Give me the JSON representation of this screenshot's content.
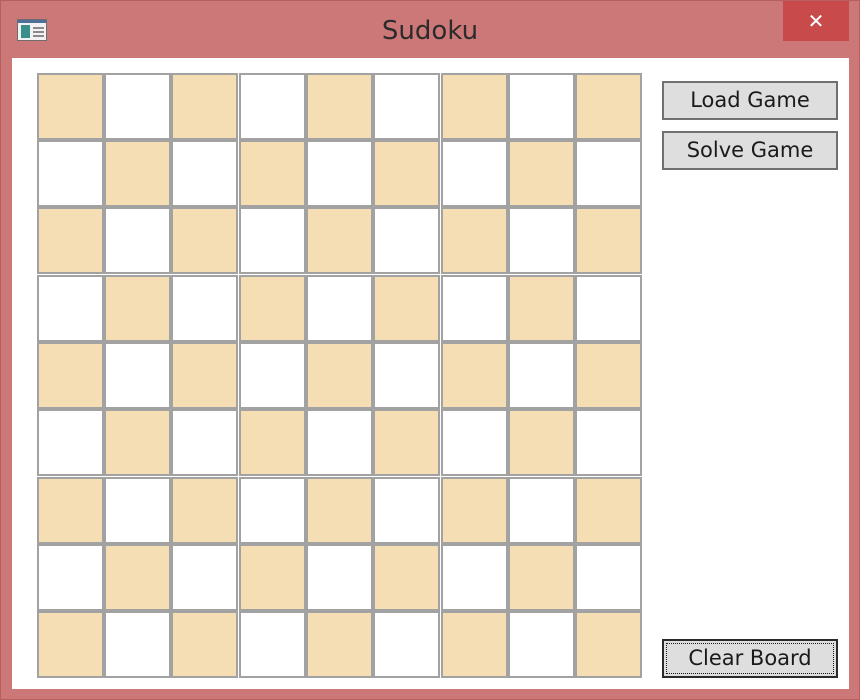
{
  "window": {
    "title": "Sudoku",
    "close_glyph": "✕",
    "app_icon": "window-app-icon"
  },
  "buttons": {
    "load_game": "Load Game",
    "solve_game": "Solve Game",
    "clear_board": "Clear Board"
  },
  "board": {
    "size": 9,
    "cell_colors": {
      "tan": "#f5deb3",
      "white": "#ffffff"
    },
    "cells": [
      [
        "",
        "",
        "",
        "",
        "",
        "",
        "",
        "",
        ""
      ],
      [
        "",
        "",
        "",
        "",
        "",
        "",
        "",
        "",
        ""
      ],
      [
        "",
        "",
        "",
        "",
        "",
        "",
        "",
        "",
        ""
      ],
      [
        "",
        "",
        "",
        "",
        "",
        "",
        "",
        "",
        ""
      ],
      [
        "",
        "",
        "",
        "",
        "",
        "",
        "",
        "",
        ""
      ],
      [
        "",
        "",
        "",
        "",
        "",
        "",
        "",
        "",
        ""
      ],
      [
        "",
        "",
        "",
        "",
        "",
        "",
        "",
        "",
        ""
      ],
      [
        "",
        "",
        "",
        "",
        "",
        "",
        "",
        "",
        ""
      ],
      [
        "",
        "",
        "",
        "",
        "",
        "",
        "",
        "",
        ""
      ]
    ]
  },
  "colors": {
    "window_frame": "#cd7878",
    "close_button": "#c94a4a"
  }
}
